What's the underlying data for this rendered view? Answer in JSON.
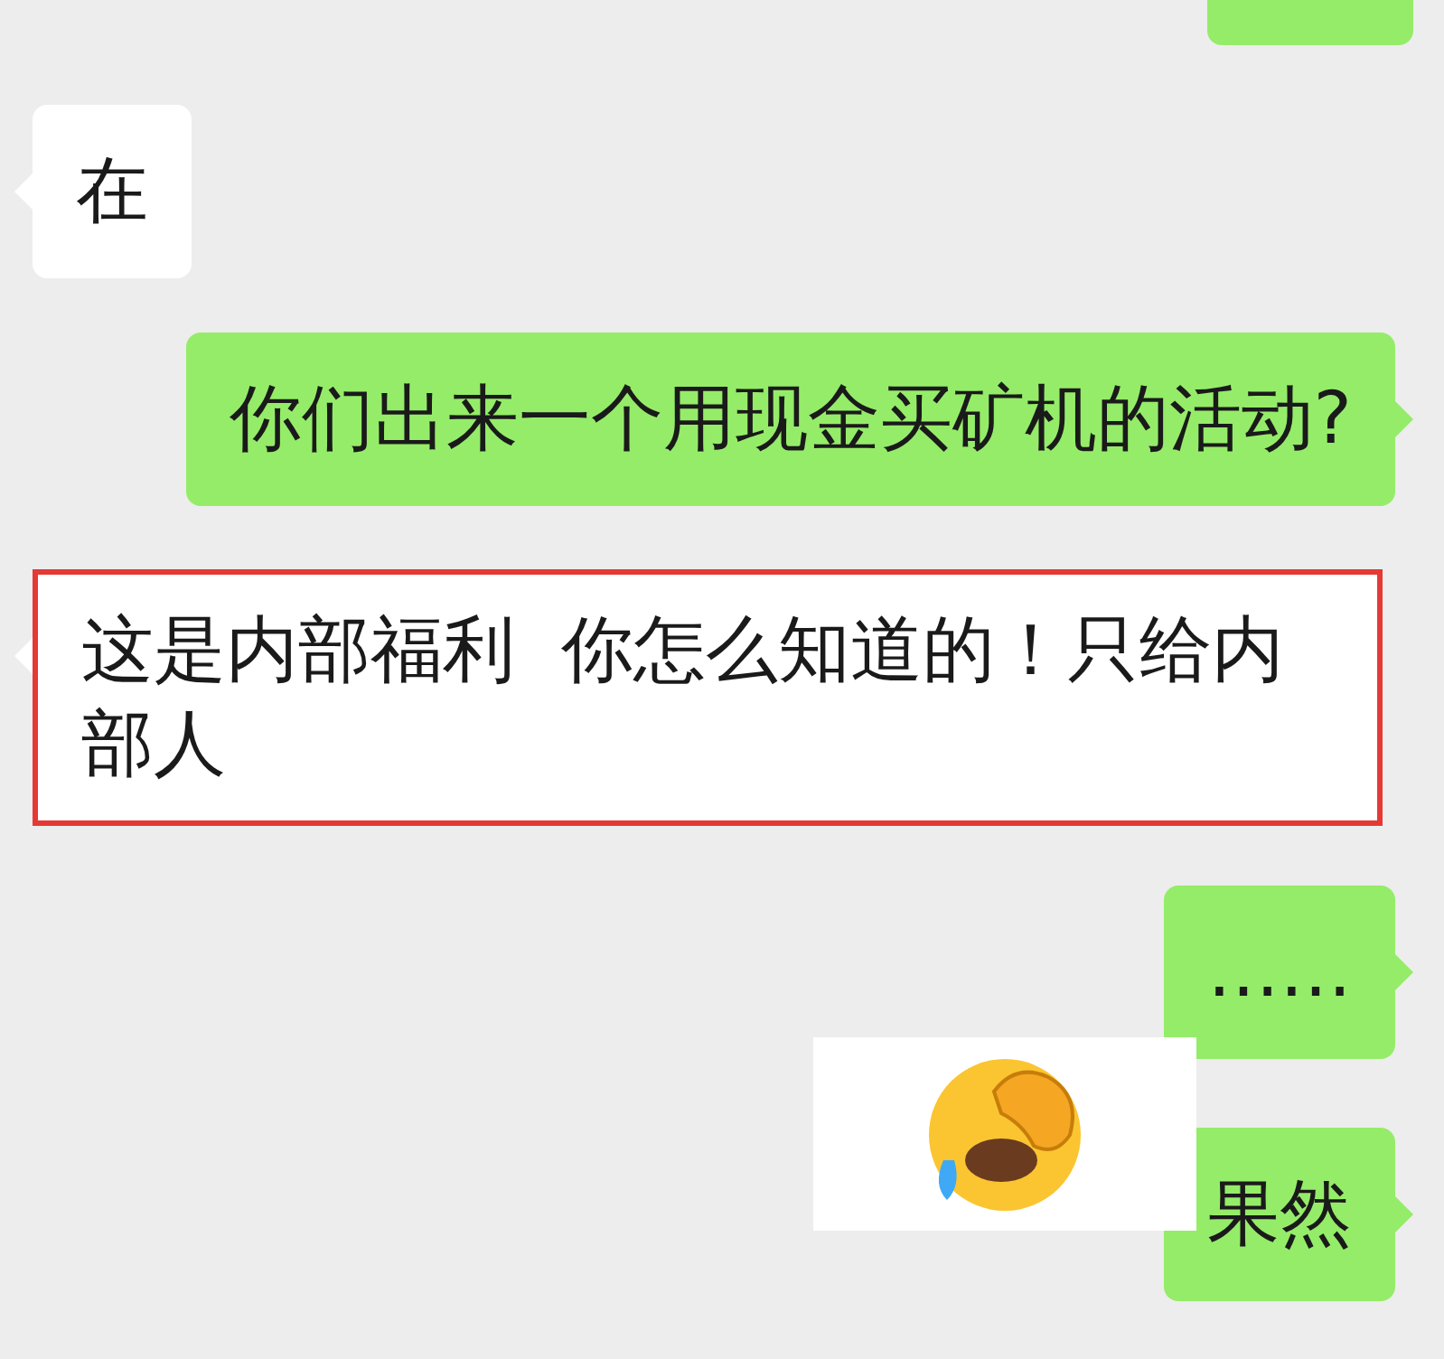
{
  "messages": [
    {
      "outgoing": true,
      "kind": "partial"
    },
    {
      "outgoing": false,
      "kind": "text",
      "text": "在",
      "highlighted": false
    },
    {
      "outgoing": true,
      "kind": "text",
      "text": "你们出来一个用现金买矿机的活动?",
      "highlighted": false
    },
    {
      "outgoing": false,
      "kind": "text",
      "text": "这是内部福利  你怎么知道的！只给内部人",
      "highlighted": true
    },
    {
      "outgoing": true,
      "kind": "text",
      "text": "……",
      "highlighted": false
    },
    {
      "outgoing": true,
      "kind": "sticker"
    },
    {
      "outgoing": true,
      "kind": "text",
      "text": "果然",
      "highlighted": false
    }
  ]
}
